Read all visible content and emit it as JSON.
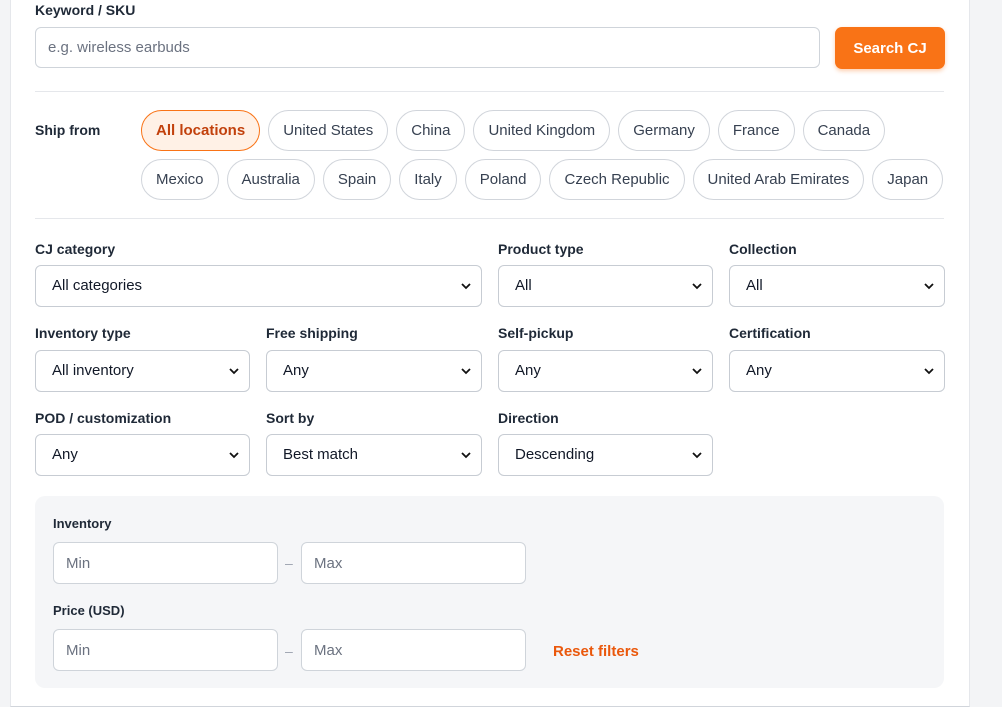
{
  "keyword": {
    "label": "Keyword / SKU",
    "placeholder": "e.g. wireless earbuds",
    "value": "",
    "search_button": "Search CJ"
  },
  "ship_from": {
    "label": "Ship from",
    "row1": [
      "All locations",
      "United States",
      "China",
      "United Kingdom",
      "Germany",
      "France",
      "Canada"
    ],
    "row2": [
      "Mexico",
      "Australia",
      "Spain",
      "Italy",
      "Poland",
      "Czech Republic",
      "United Arab Emirates",
      "Japan"
    ],
    "selected": "All locations"
  },
  "filters": {
    "cj_category": {
      "label": "CJ category",
      "value": "All categories"
    },
    "product_type": {
      "label": "Product type",
      "value": "All"
    },
    "collection": {
      "label": "Collection",
      "value": "All"
    },
    "inventory_type": {
      "label": "Inventory type",
      "value": "All inventory"
    },
    "free_shipping": {
      "label": "Free shipping",
      "value": "Any"
    },
    "self_pickup": {
      "label": "Self-pickup",
      "value": "Any"
    },
    "certification": {
      "label": "Certification",
      "value": "Any"
    },
    "pod": {
      "label": "POD / customization",
      "value": "Any"
    },
    "sort_by": {
      "label": "Sort by",
      "value": "Best match"
    },
    "direction": {
      "label": "Direction",
      "value": "Descending"
    }
  },
  "ranges": {
    "inventory": {
      "label": "Inventory",
      "min_placeholder": "Min",
      "max_placeholder": "Max",
      "separator": "–"
    },
    "price": {
      "label": "Price (USD)",
      "min_placeholder": "Min",
      "max_placeholder": "Max",
      "separator": "–"
    },
    "reset_label": "Reset filters"
  },
  "colors": {
    "accent": "#f97316",
    "accent_text": "#c2410c",
    "panel_bg": "#f5f6f8"
  }
}
